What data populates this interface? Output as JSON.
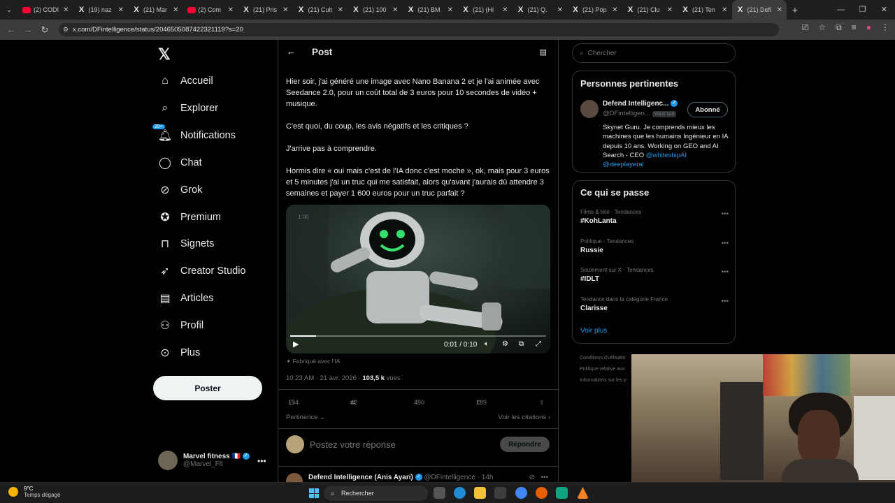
{
  "browser": {
    "tabs": [
      {
        "label": "(2) CODI",
        "icon": "youtube-icon"
      },
      {
        "label": "(19) naz",
        "icon": "x-icon"
      },
      {
        "label": "(21) Mar",
        "icon": "x-icon"
      },
      {
        "label": "(2) Com",
        "icon": "youtube-icon"
      },
      {
        "label": "(21) Pris",
        "icon": "x-icon"
      },
      {
        "label": "(21) Cult",
        "icon": "x-icon"
      },
      {
        "label": "(21) 100",
        "icon": "x-icon"
      },
      {
        "label": "(21) BM",
        "icon": "x-icon"
      },
      {
        "label": "(21) (Hi",
        "icon": "x-icon"
      },
      {
        "label": "(21) Q.",
        "icon": "x-icon"
      },
      {
        "label": "(21) Pop",
        "icon": "x-icon"
      },
      {
        "label": "(21) Clu",
        "icon": "x-icon"
      },
      {
        "label": "(21) Ten",
        "icon": "x-icon"
      },
      {
        "label": "(21) Defi",
        "icon": "x-icon",
        "active": true
      }
    ],
    "url": "x.com/DFintelligence/status/2046505087422321119?s=20"
  },
  "nav": {
    "items": [
      {
        "label": "Accueil",
        "icon": "home-icon"
      },
      {
        "label": "Explorer",
        "icon": "search-icon"
      },
      {
        "label": "Notifications",
        "icon": "bell-icon",
        "badge": "20+"
      },
      {
        "label": "Chat",
        "icon": "chat-icon"
      },
      {
        "label": "Grok",
        "icon": "grok-icon"
      },
      {
        "label": "Premium",
        "icon": "premium-icon"
      },
      {
        "label": "Signets",
        "icon": "bookmark-icon"
      },
      {
        "label": "Creator Studio",
        "icon": "rocket-icon"
      },
      {
        "label": "Articles",
        "icon": "article-icon"
      },
      {
        "label": "Profil",
        "icon": "profile-icon"
      },
      {
        "label": "Plus",
        "icon": "more-icon"
      }
    ],
    "post_button": "Poster",
    "account": {
      "name": "Marvel fitness 🇫🇷",
      "handle": "@Marvel_Flt"
    }
  },
  "post": {
    "header": "Post",
    "paragraphs": [
      "Hier soir, j'ai généré une image avec Nano Banana 2 et je l'ai animée avec Seedance 2.0, pour un coût total de 3 euros pour 10 secondes de vidéo + musique.",
      "C'est quoi, du coup, les avis négatifs et les critiques ?",
      "J'arrive pas à comprendre.",
      "Hormis dire « oui mais c'est de l'IA donc c'est moche », ok, mais pour 3 euros et 5 minutes j'ai un truc qui me satisfait, alors qu'avant j'aurais dû attendre 3 semaines et payer 1 600 euros pour un truc parfait ?"
    ],
    "video": {
      "time": "0:01 / 0:10",
      "progress": 0.1
    },
    "ai_tag": "Fabriqué avec l'IA",
    "timestamp": "10:23 AM · 21 avr. 2026 · ",
    "views_count": "103,5 k",
    "views_label": "vues",
    "stats": {
      "replies": "194",
      "reposts": "42",
      "likes": "490",
      "bookmarks": "189"
    },
    "sort_label": "Pertinence",
    "quotes_label": "Voir les citations",
    "reply_placeholder": "Postez votre réponse",
    "reply_button": "Répondre",
    "next": {
      "name": "Defend Intelligence (Anis Ayari)",
      "handle": "@DFintelligence",
      "time": "· 14h"
    }
  },
  "sidebar": {
    "search_placeholder": "Chercher",
    "relevant_title": "Personnes pertinentes",
    "person": {
      "name": "Defend Intelligenc...",
      "handle": "@DFintelligen...",
      "follows_you": "Vous suit",
      "follow_state": "Abonné",
      "bio": "Skynet Guru. Je comprends mieux les machines que les humains Ingénieur en IA depuis 10 ans. Working on GEO and AI Search - CEO ",
      "link1": "@whiteshipAI",
      "link2": "@deeplayeral"
    },
    "trends_title": "Ce qui se passe",
    "trends": [
      {
        "category": "Films & télé · Tendances",
        "title": "#KohLanta"
      },
      {
        "category": "Politique · Tendances",
        "title": "Russie"
      },
      {
        "category": "Seulement sur X · Tendances",
        "title": "#IDLT"
      },
      {
        "category": "Tendance dans la catégorie France",
        "title": "Clarisse"
      }
    ],
    "more_link": "Voir plus",
    "footer": [
      "Conditions d'utilisatio",
      "Politique relative aux",
      "Informations sur les p"
    ]
  },
  "taskbar": {
    "temp": "9°C",
    "weather": "Temps dégagé",
    "search": "Rechercher"
  },
  "colors": {
    "accent": "#1d9bf0",
    "background": "#000000",
    "text": "#e7e9ea",
    "muted": "#71767b"
  }
}
